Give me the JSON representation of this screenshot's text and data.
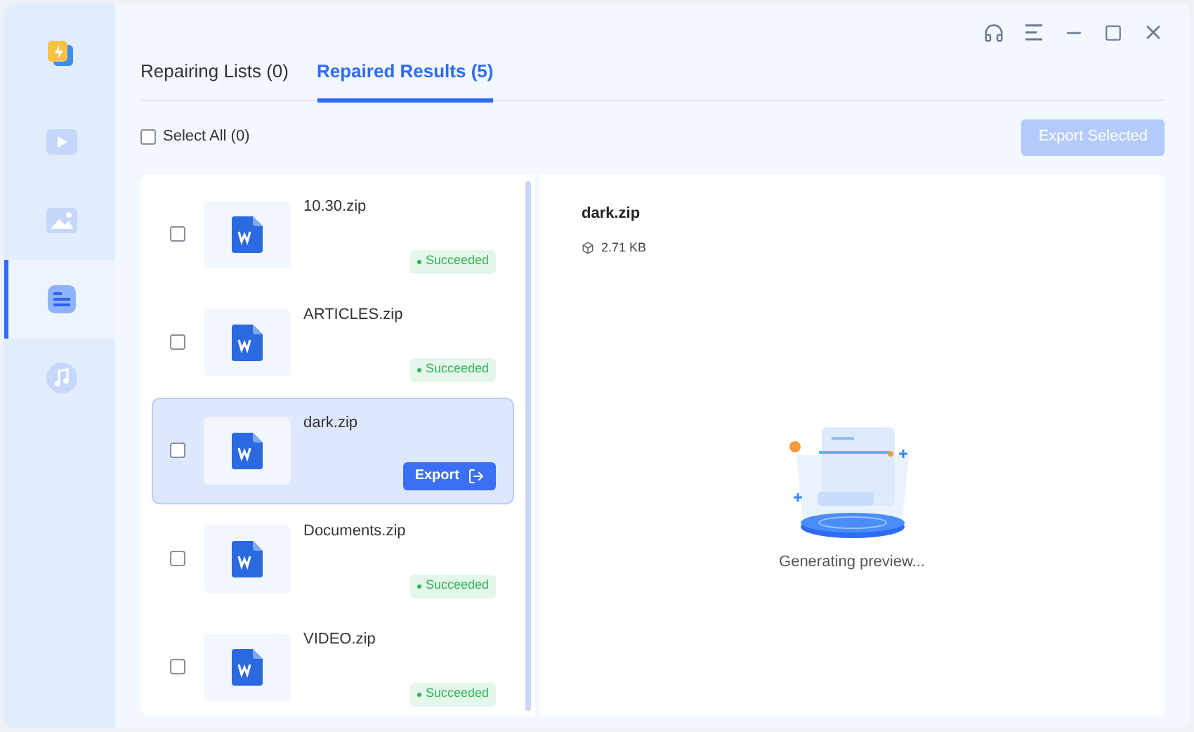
{
  "sidebar": {
    "items": [
      {
        "kind": "video",
        "selected": false
      },
      {
        "kind": "image",
        "selected": false
      },
      {
        "kind": "document",
        "selected": true
      },
      {
        "kind": "music",
        "selected": false
      }
    ]
  },
  "tabs": [
    {
      "label": "Repairing Lists (0)",
      "selected": false
    },
    {
      "label": "Repaired Results (5)",
      "selected": true
    }
  ],
  "select_all": {
    "label": "Select All (0)",
    "checked": false
  },
  "export_selected": {
    "label": "Export Selected",
    "disabled": true
  },
  "files": [
    {
      "name": "10.30.zip",
      "checked": false,
      "selected": false,
      "kind": "status",
      "status": "Succeeded"
    },
    {
      "name": "ARTICLES.zip",
      "checked": false,
      "selected": false,
      "kind": "status",
      "status": "Succeeded"
    },
    {
      "name": "dark.zip",
      "checked": false,
      "selected": true,
      "kind": "action",
      "status": "Export"
    },
    {
      "name": "Documents.zip",
      "checked": false,
      "selected": false,
      "kind": "status",
      "status": "Succeeded"
    },
    {
      "name": "VIDEO.zip",
      "checked": false,
      "selected": false,
      "kind": "status",
      "status": "Succeeded"
    }
  ],
  "preview": {
    "name": "dark.zip",
    "size": "2.71 KB",
    "message": "Generating preview..."
  }
}
